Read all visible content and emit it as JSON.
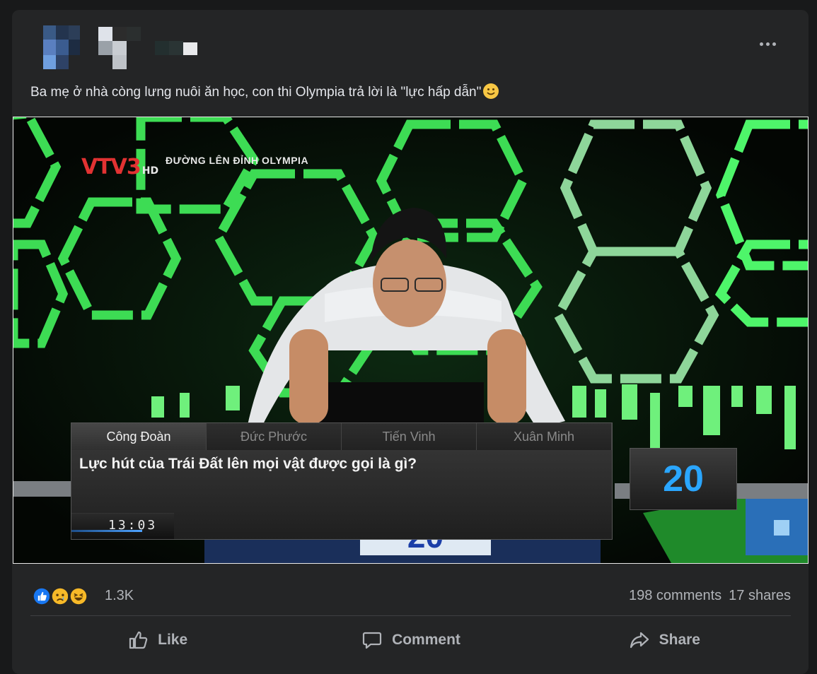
{
  "post": {
    "author": "",
    "caption": "Ba mẹ ở nhà còng lưng nuôi ăn học, con thi Olympia trả lời là \"lực hấp dẫn\""
  },
  "media": {
    "channel_logo": "VTV3",
    "hd_label": "HD",
    "show_title": "ĐƯỜNG LÊN ĐỈNH OLYMPIA",
    "contestants": [
      "Công Đoàn",
      "Đức Phước",
      "Tiến Vinh",
      "Xuân Minh"
    ],
    "question": "Lực hút của Trái Đất lên mọi vật được gọi là gì?",
    "timer": "13:03",
    "score": "20",
    "stage_score": "20"
  },
  "stats": {
    "reaction_icons": [
      "like-icon",
      "sad-icon",
      "haha-icon"
    ],
    "reaction_count": "1.3K",
    "comments": "198 comments",
    "shares": "17 shares"
  },
  "actions": {
    "like": "Like",
    "comment": "Comment",
    "share": "Share"
  },
  "colors": {
    "background": "#18191a",
    "card": "#242526",
    "secondary_text": "#b0b3b8",
    "hex_green": "#3ddc54",
    "score_blue": "#2aa6ff"
  }
}
